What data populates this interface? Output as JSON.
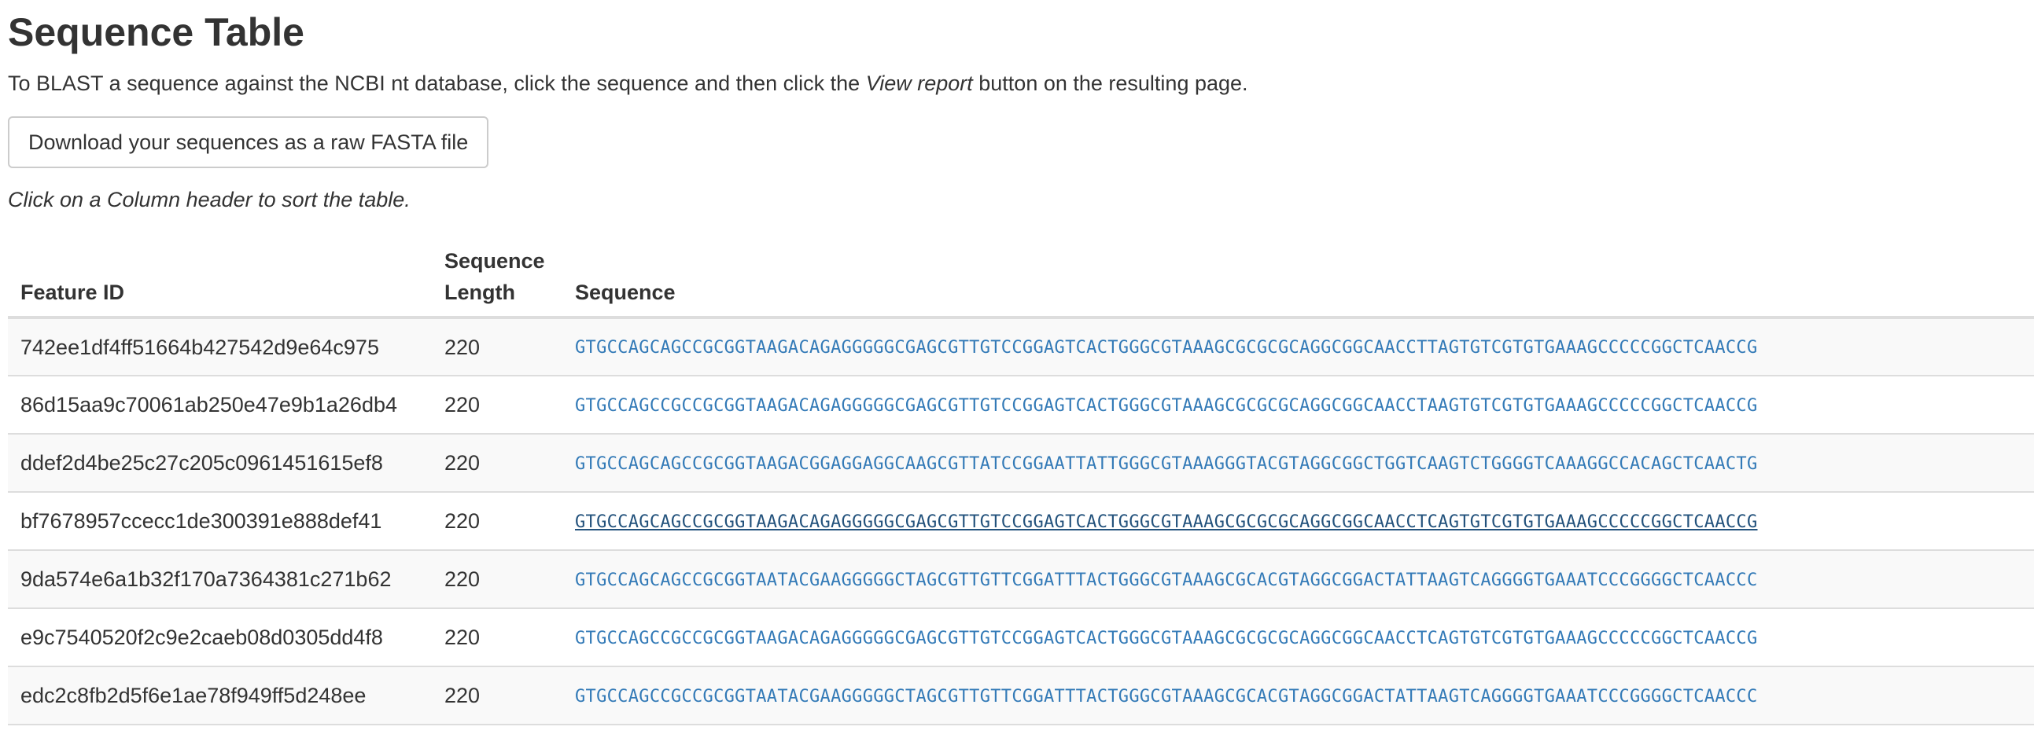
{
  "title": "Sequence Table",
  "intro": {
    "before": "To BLAST a sequence against the NCBI nt database, click the sequence and then click the ",
    "emphasis": "View report",
    "after": " button on the resulting page."
  },
  "download_button": "Download your sequences as a raw FASTA file",
  "sort_note": "Click on a Column header to sort the table.",
  "table": {
    "headers": {
      "feature_id": "Feature ID",
      "length": "Sequence Length",
      "sequence": "Sequence"
    },
    "rows": [
      {
        "id": "742ee1df4ff51664b427542d9e64c975",
        "length": "220",
        "sequence": "GTGCCAGCAGCCGCGGTAAGACAGAGGGGGCGAGCGTTGTCCGGAGTCACTGGGCGTAAAGCGCGCGCAGGCGGCAACCTTAGTGTCGTGTGAAAGCCCCCGGCTCAACCG",
        "hovered": false
      },
      {
        "id": "86d15aa9c70061ab250e47e9b1a26db4",
        "length": "220",
        "sequence": "GTGCCAGCCGCCGCGGTAAGACAGAGGGGGCGAGCGTTGTCCGGAGTCACTGGGCGTAAAGCGCGCGCAGGCGGCAACCTAAGTGTCGTGTGAAAGCCCCCGGCTCAACCG",
        "hovered": false
      },
      {
        "id": "ddef2d4be25c27c205c0961451615ef8",
        "length": "220",
        "sequence": "GTGCCAGCAGCCGCGGTAAGACGGAGGAGGCAAGCGTTATCCGGAATTATTGGGCGTAAAGGGTACGTAGGCGGCTGGTCAAGTCTGGGGTCAAAGGCCACAGCTCAACTG",
        "hovered": false
      },
      {
        "id": "bf7678957ccecc1de300391e888def41",
        "length": "220",
        "sequence": "GTGCCAGCAGCCGCGGTAAGACAGAGGGGGCGAGCGTTGTCCGGAGTCACTGGGCGTAAAGCGCGCGCAGGCGGCAACCTCAGTGTCGTGTGAAAGCCCCCGGCTCAACCG",
        "hovered": true
      },
      {
        "id": "9da574e6a1b32f170a7364381c271b62",
        "length": "220",
        "sequence": "GTGCCAGCAGCCGCGGTAATACGAAGGGGGCTAGCGTTGTTCGGATTTACTGGGCGTAAAGCGCACGTAGGCGGACTATTAAGTCAGGGGTGAAATCCCGGGGCTCAACCC",
        "hovered": false
      },
      {
        "id": "e9c7540520f2c9e2caeb08d0305dd4f8",
        "length": "220",
        "sequence": "GTGCCAGCCGCCGCGGTAAGACAGAGGGGGCGAGCGTTGTCCGGAGTCACTGGGCGTAAAGCGCGCGCAGGCGGCAACCTCAGTGTCGTGTGAAAGCCCCCGGCTCAACCG",
        "hovered": false
      },
      {
        "id": "edc2c8fb2d5f6e1ae78f949ff5d248ee",
        "length": "220",
        "sequence": "GTGCCAGCCGCCGCGGTAATACGAAGGGGGCTAGCGTTGTTCGGATTTACTGGGCGTAAAGCGCACGTAGGCGGACTATTAAGTCAGGGGTGAAATCCCGGGGCTCAACCC",
        "hovered": false
      }
    ]
  },
  "colors": {
    "link": "#337ab7",
    "link_hover": "#23527c",
    "text": "#333333",
    "row_stripe": "#f9f9f9",
    "border": "#dddddd"
  }
}
